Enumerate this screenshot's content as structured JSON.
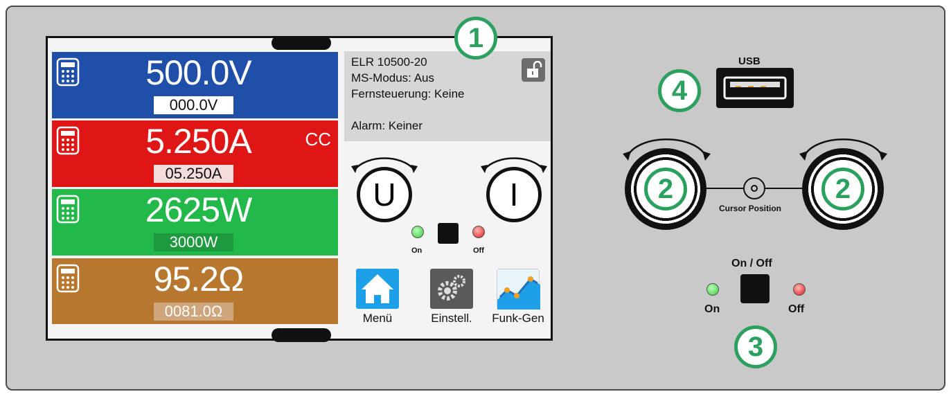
{
  "screen": {
    "voltage": {
      "actual": "500.0V",
      "set": "000.0V",
      "color": "#1f4fa8"
    },
    "current": {
      "actual": "5.250A",
      "set": "05.250A",
      "mode": "CC",
      "color": "#e01515"
    },
    "power": {
      "actual": "2625W",
      "set": "3000W",
      "color": "#22b84a"
    },
    "resistance": {
      "actual": "95.2Ω",
      "set": "0081.0Ω",
      "color": "#b8772e"
    },
    "info": {
      "device": "ELR 10500-20",
      "ms_mode": "MS-Modus: Aus",
      "remote": "Fernsteuerung: Keine",
      "alarm": "Alarm: Keiner"
    },
    "knob_u_label": "U",
    "knob_i_label": "I",
    "led_on_label": "On",
    "led_off_label": "Off",
    "apps": [
      {
        "label": "Menü",
        "icon": "home-icon"
      },
      {
        "label": "Einstell.",
        "icon": "gear-icon"
      },
      {
        "label": "Funk-Gen",
        "icon": "function-generator-icon"
      }
    ]
  },
  "panel": {
    "usb_label": "USB",
    "cursor_label": "Cursor Position",
    "onoff_label": "On / Off",
    "on_label": "On",
    "off_label": "Off"
  },
  "callouts": [
    "1",
    "2",
    "2",
    "3",
    "4"
  ],
  "colors": {
    "callout": "#2ca15f",
    "led_green": "#3cc83c",
    "led_red": "#e01515"
  }
}
